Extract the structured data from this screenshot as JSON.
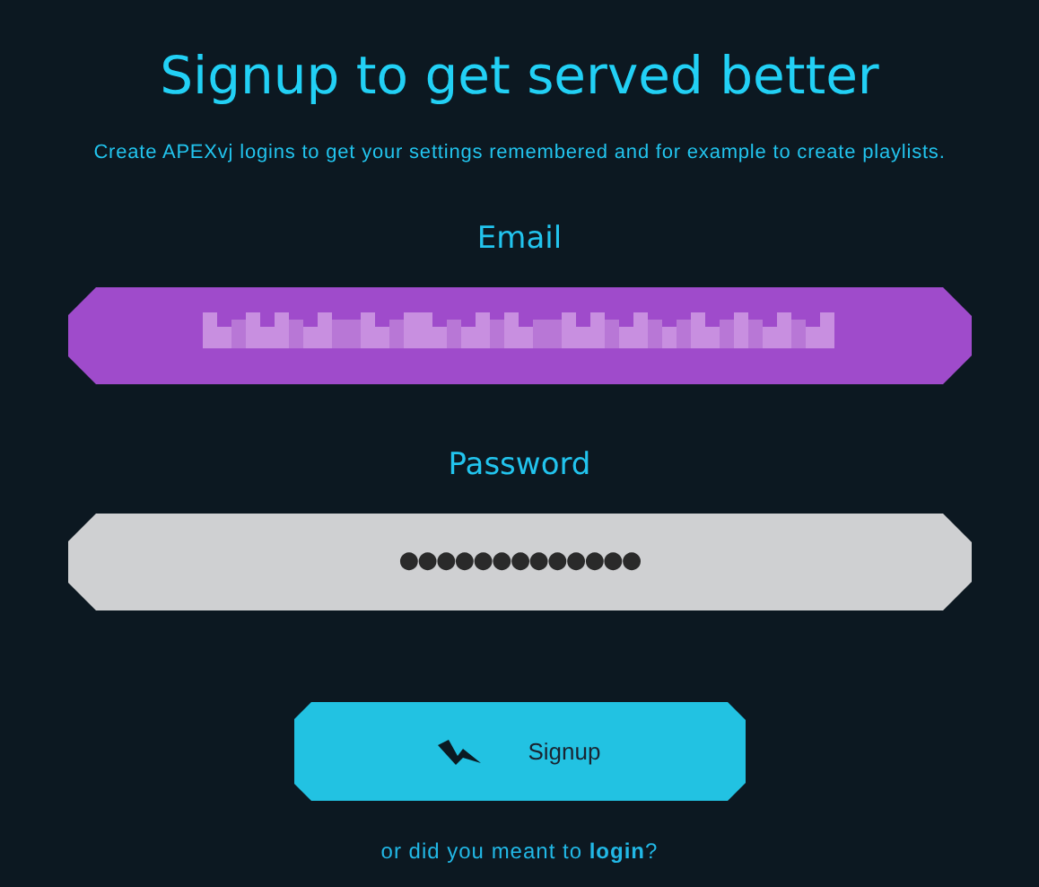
{
  "title": "Signup to get served better",
  "subtitle": "Create APEXvj logins to get your settings remembered and for example to create playlists.",
  "email": {
    "label": "Email",
    "value_redacted": true
  },
  "password": {
    "label": "Password",
    "value": "●●●●●●●●●●●●●"
  },
  "signup_button": {
    "label": "Signup"
  },
  "login_prompt": {
    "before": "or did you meant to ",
    "link": "login",
    "after": "?"
  }
}
